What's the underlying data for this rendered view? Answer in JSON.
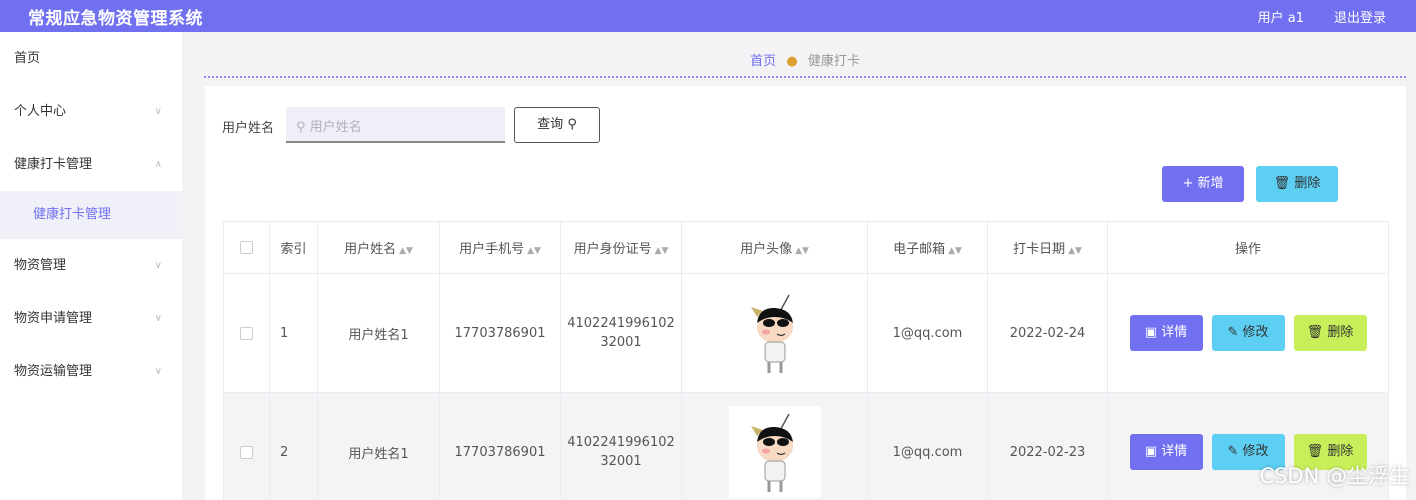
{
  "header": {
    "title": "常规应急物资管理系统",
    "user_label": "用户 a1",
    "logout_label": "退出登录"
  },
  "sidebar": {
    "items": [
      {
        "label": "首页",
        "expandable": false
      },
      {
        "label": "个人中心",
        "expandable": true
      },
      {
        "label": "健康打卡管理",
        "expandable": true,
        "expanded": true,
        "children": [
          "健康打卡管理"
        ]
      },
      {
        "label": "物资管理",
        "expandable": true
      },
      {
        "label": "物资申请管理",
        "expandable": true
      },
      {
        "label": "物资运输管理",
        "expandable": true
      }
    ]
  },
  "breadcrumb": {
    "home": "首页",
    "current": "健康打卡"
  },
  "search": {
    "label": "用户姓名",
    "placeholder": "用户姓名",
    "query_button": "查询"
  },
  "toolbar": {
    "add_label": "新增",
    "delete_label": "删除"
  },
  "table": {
    "columns": [
      "索引",
      "用户姓名",
      "用户手机号",
      "用户身份证号",
      "用户头像",
      "电子邮箱",
      "打卡日期",
      "操作"
    ],
    "rows": [
      {
        "index": "1",
        "name": "用户姓名1",
        "phone": "17703786901",
        "id_line1": "4102241996102",
        "id_line2": "32001",
        "avatar": "cartoon-avatar",
        "email": "1@qq.com",
        "date": "2022-02-24"
      },
      {
        "index": "2",
        "name": "用户姓名1",
        "phone": "17703786901",
        "id_line1": "4102241996102",
        "id_line2": "32001",
        "avatar": "cartoon-avatar",
        "email": "1@qq.com",
        "date": "2022-02-23"
      }
    ],
    "actions": {
      "detail": "详情",
      "edit": "修改",
      "delete": "删除"
    }
  },
  "watermark": "CSDN @尘浮生",
  "colors": {
    "primary": "#7070f0",
    "cyan": "#5ccff2",
    "lime": "#c8ef5a"
  }
}
